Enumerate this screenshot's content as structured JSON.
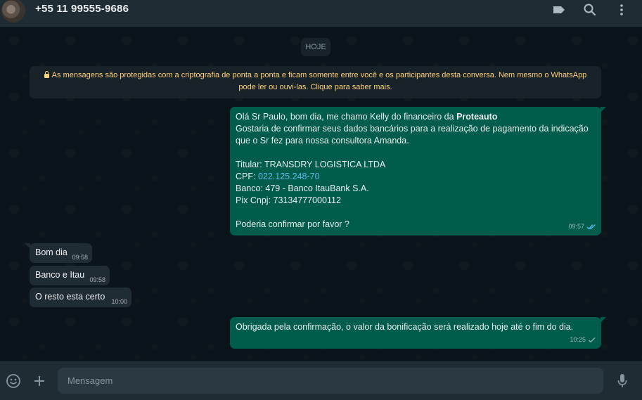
{
  "header": {
    "contact_name": "+55 11 99555-9686",
    "icons": [
      "label-icon",
      "search-icon",
      "menu-icon"
    ]
  },
  "chat": {
    "date_label": "HOJE",
    "encryption_notice": "As mensagens são protegidas com a criptografia de ponta a ponta e ficam somente entre você e os participantes desta conversa. Nem mesmo o WhatsApp pode ler ou ouvi-las. Clique para saber mais.",
    "outgoing_1": {
      "line1_prefix": "Olá Sr Paulo, bom dia, me chamo Kelly do financeiro da ",
      "line1_bold": "Proteauto",
      "line2": "Gostaria de confirmar seus dados bancários para a realização de pagamento da indicação que o Sr fez para nossa consultora Amanda.",
      "titular": "Titular: TRANSDRY LOGISTICA LTDA",
      "cpf_label": "CPF: ",
      "cpf_value": "022.125.248-70",
      "banco": "Banco: 479 - Banco ItauBank S.A.",
      "pix": "Pix Cnpj: 73134777000112",
      "closing": "Poderia confirmar por favor ?",
      "time": "09:57"
    },
    "incoming": [
      {
        "text": "Bom dia",
        "time": "09:58"
      },
      {
        "text": "Banco e Itau",
        "time": "09:58"
      },
      {
        "text": "O resto esta certo",
        "time": "10:00"
      }
    ],
    "outgoing_2": {
      "text": "Obrigada pela confirmação, o valor da bonificação será realizado hoje até o fim do dia.",
      "time": "10:25"
    }
  },
  "footer": {
    "input_placeholder": "Mensagem",
    "input_value": "",
    "icons": [
      "emoji-icon",
      "plus-icon",
      "microphone-icon"
    ]
  },
  "colors": {
    "header_bg": "#202c33",
    "chat_bg": "#0b141a",
    "outgoing_bubble": "#005c4b",
    "incoming_bubble": "#202c33",
    "notice_text": "#ffd279",
    "link": "#53bdeb",
    "read_ticks": "#53bdeb"
  }
}
